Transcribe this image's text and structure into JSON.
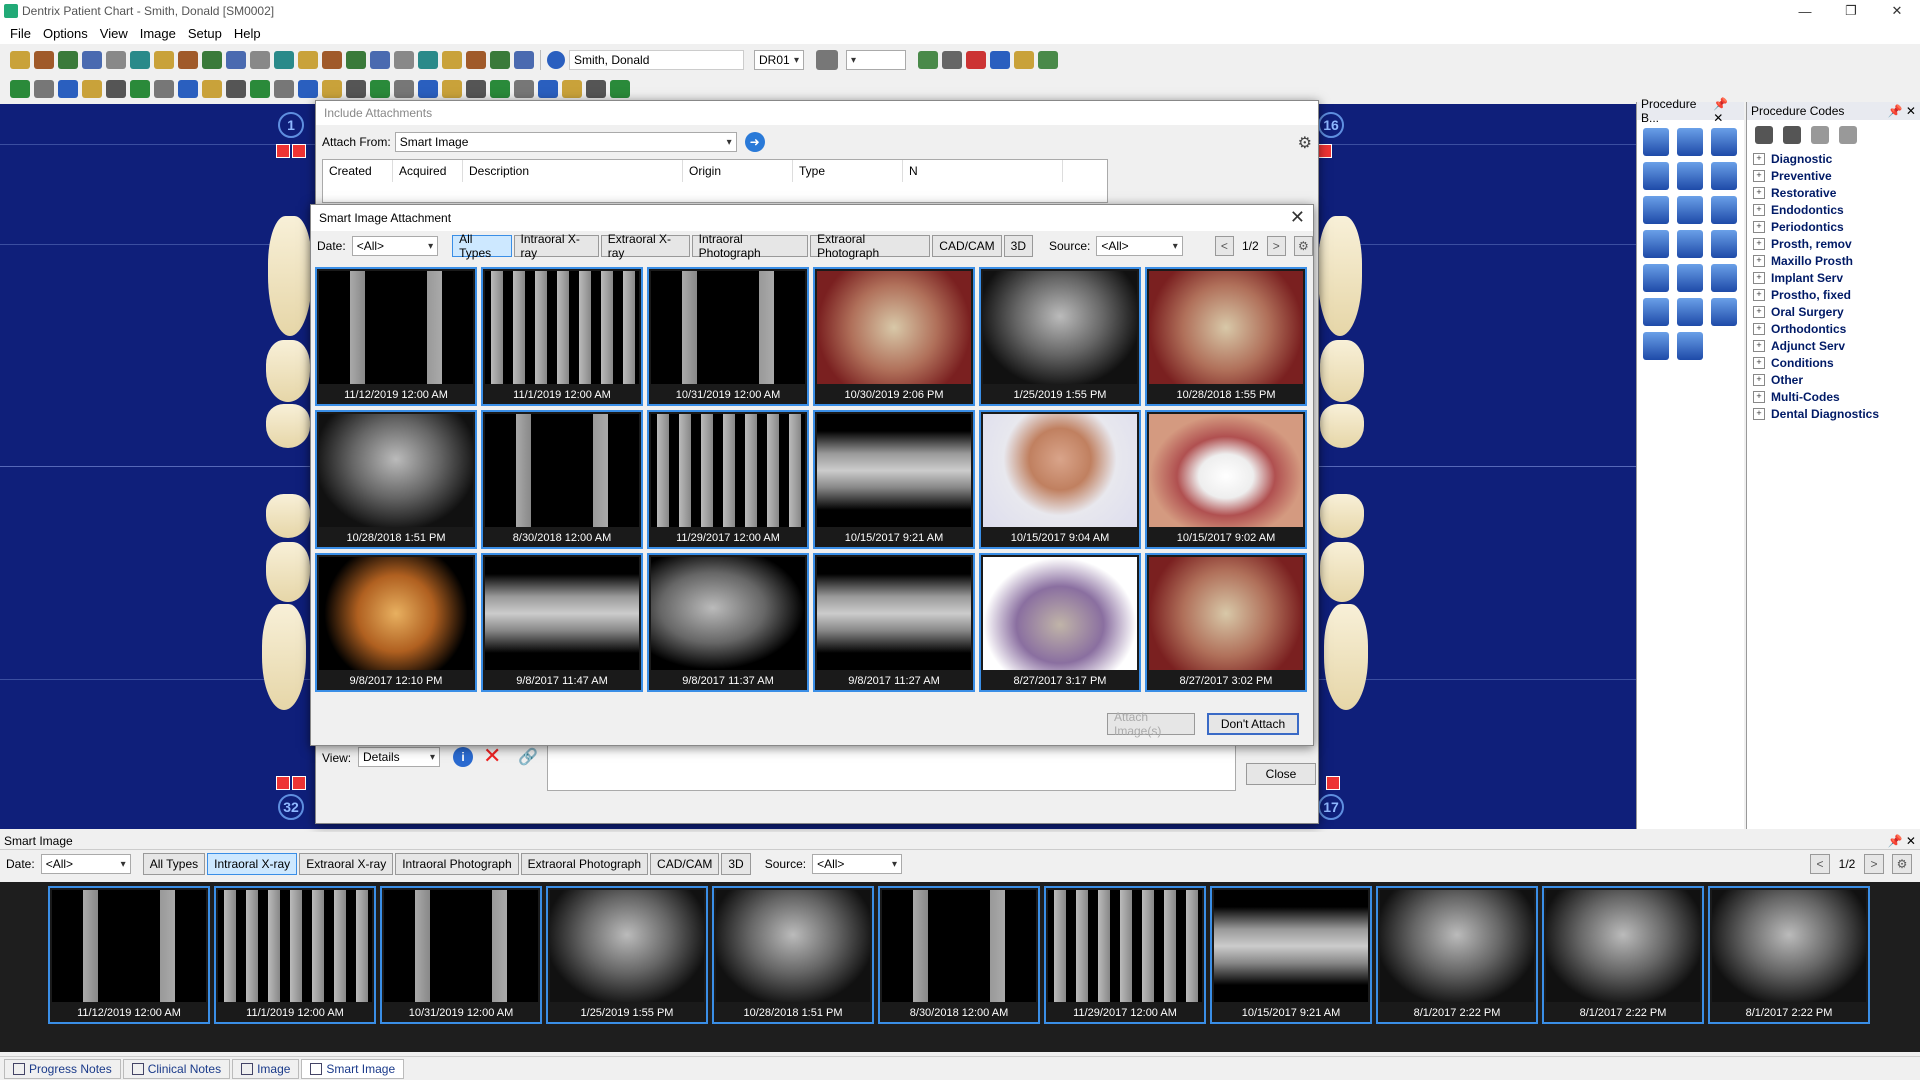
{
  "window": {
    "title": "Dentrix Patient Chart - Smith, Donald [SM0002]",
    "minimize": "—",
    "restore": "❐",
    "close": "✕"
  },
  "menu": [
    "File",
    "Options",
    "View",
    "Image",
    "Setup",
    "Help"
  ],
  "toolbar": {
    "patient": "Smith, Donald",
    "provider": "DR01",
    "blank_combo": ""
  },
  "chart": {
    "tooth_top_left": "1",
    "tooth_top_right": "16",
    "tooth_bottom_left": "32",
    "tooth_bottom_right": "17"
  },
  "procedure_buttons_panel": {
    "title": "Procedure B..."
  },
  "procedure_codes_panel": {
    "title": "Procedure Codes",
    "items": [
      "Diagnostic",
      "Preventive",
      "Restorative",
      "Endodontics",
      "Periodontics",
      "Prosth, remov",
      "Maxillo Prosth",
      "Implant Serv",
      "Prostho, fixed",
      "Oral Surgery",
      "Orthodontics",
      "Adjunct Serv",
      "Conditions",
      "Other",
      "Multi-Codes",
      "Dental Diagnostics"
    ]
  },
  "include_attachments": {
    "title": "Include Attachments",
    "attach_from_label": "Attach From:",
    "attach_from_value": "Smart Image",
    "columns": [
      "Created",
      "Acquired",
      "Description",
      "Origin",
      "Type",
      "N"
    ],
    "view_label": "View:",
    "view_value": "Details",
    "close_label": "Close"
  },
  "smart_attach": {
    "title": "Smart Image Attachment",
    "date_label": "Date:",
    "date_value": "<All>",
    "types": [
      "All Types",
      "Intraoral X-ray",
      "Extraoral X-ray",
      "Intraoral Photograph",
      "Extraoral Photograph",
      "CAD/CAM",
      "3D"
    ],
    "active_type": "All Types",
    "source_label": "Source:",
    "source_value": "<All>",
    "page": "1/2",
    "prev": "<",
    "next": ">",
    "attach_button": "Attach Image(s)",
    "dont_attach_button": "Don't Attach",
    "images": [
      {
        "date": "11/12/2019 12:00 AM",
        "kind": "bw"
      },
      {
        "date": "11/1/2019 12:00 AM",
        "kind": "fmx"
      },
      {
        "date": "10/31/2019 12:00 AM",
        "kind": "bw"
      },
      {
        "date": "10/30/2019 2:06 PM",
        "kind": "photo"
      },
      {
        "date": "1/25/2019 1:55 PM",
        "kind": "xray"
      },
      {
        "date": "10/28/2018 1:55 PM",
        "kind": "photo"
      },
      {
        "date": "10/28/2018 1:51 PM",
        "kind": "xray"
      },
      {
        "date": "8/30/2018 12:00 AM",
        "kind": "bw"
      },
      {
        "date": "11/29/2017 12:00 AM",
        "kind": "fmx"
      },
      {
        "date": "10/15/2017 9:21 AM",
        "kind": "pano"
      },
      {
        "date": "10/15/2017 9:04 AM",
        "kind": "face"
      },
      {
        "date": "10/15/2017 9:02 AM",
        "kind": "smile"
      },
      {
        "date": "9/8/2017 12:10 PM",
        "kind": "skull"
      },
      {
        "date": "9/8/2017 11:47 AM",
        "kind": "pano"
      },
      {
        "date": "9/8/2017 11:37 AM",
        "kind": "ceph"
      },
      {
        "date": "9/8/2017 11:27 AM",
        "kind": "pano"
      },
      {
        "date": "8/27/2017 3:17 PM",
        "kind": "cad"
      },
      {
        "date": "8/27/2017 3:02 PM",
        "kind": "photo"
      }
    ]
  },
  "smart_image_panel": {
    "title": "Smart Image",
    "date_label": "Date:",
    "date_value": "<All>",
    "types": [
      "All Types",
      "Intraoral X-ray",
      "Extraoral X-ray",
      "Intraoral Photograph",
      "Extraoral Photograph",
      "CAD/CAM",
      "3D"
    ],
    "active_type": "Intraoral X-ray",
    "source_label": "Source:",
    "source_value": "<All>",
    "page": "1/2",
    "prev": "<",
    "next": ">",
    "images": [
      {
        "date": "11/12/2019 12:00 AM",
        "kind": "bw"
      },
      {
        "date": "11/1/2019 12:00 AM",
        "kind": "fmx"
      },
      {
        "date": "10/31/2019 12:00 AM",
        "kind": "bw"
      },
      {
        "date": "1/25/2019 1:55 PM",
        "kind": "xray"
      },
      {
        "date": "10/28/2018 1:51 PM",
        "kind": "xray"
      },
      {
        "date": "8/30/2018 12:00 AM",
        "kind": "bw"
      },
      {
        "date": "11/29/2017 12:00 AM",
        "kind": "fmx"
      },
      {
        "date": "10/15/2017 9:21 AM",
        "kind": "pano"
      },
      {
        "date": "8/1/2017 2:22 PM",
        "kind": "xray"
      },
      {
        "date": "8/1/2017 2:22 PM",
        "kind": "xray"
      },
      {
        "date": "8/1/2017 2:22 PM",
        "kind": "xray"
      }
    ]
  },
  "bottom_tabs": [
    "Progress Notes",
    "Clinical Notes",
    "Image",
    "Smart Image"
  ],
  "active_bottom_tab": "Smart Image"
}
